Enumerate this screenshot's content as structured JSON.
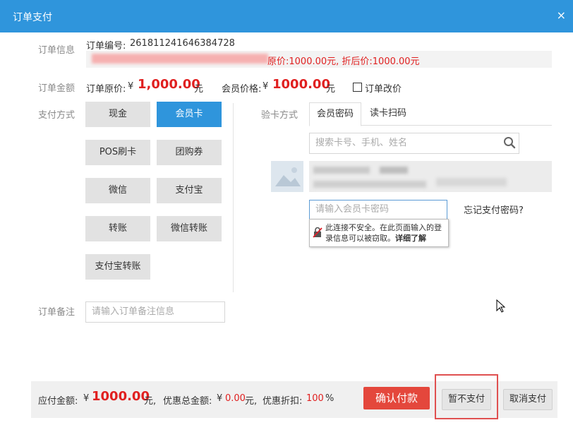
{
  "dialog": {
    "title": "订单支付",
    "close": "×"
  },
  "order_info": {
    "label": "订单信息",
    "order_no_label": "订单编号:",
    "order_no": "261811241646384728",
    "price_note": "原价:1000.00元, 折后价:1000.00元"
  },
  "amount": {
    "label": "订单金额",
    "orig_label": "订单原价:",
    "currency": "¥",
    "orig_value": "1,000.00",
    "unit": "元",
    "member_label": "会员价格:",
    "member_value": "1000.00",
    "change_label": "订单改价"
  },
  "payment": {
    "label": "支付方式",
    "methods": [
      "现金",
      "会员卡",
      "POS刷卡",
      "团购券",
      "微信",
      "支付宝",
      "转账",
      "微信转账",
      "支付宝转账"
    ],
    "selected": "会员卡"
  },
  "verify": {
    "label": "验卡方式",
    "tabs": [
      "会员密码",
      "读卡扫码"
    ],
    "search_placeholder": "搜索卡号、手机、姓名",
    "password_placeholder": "请输入会员卡密码",
    "forgot": "忘记支付密码?",
    "tooltip_text": "此连接不安全。在此页面输入的登录信息可以被窃取。",
    "tooltip_link": "详细了解"
  },
  "note": {
    "label": "订单备注",
    "placeholder": "请输入订单备注信息"
  },
  "footer": {
    "due_label": "应付金额:",
    "currency": "¥",
    "due_value": "1000.00",
    "unit": "元,",
    "discount_total_label": "优惠总金额:",
    "discount_total_currency": "¥",
    "discount_total_value": "0.00",
    "discount_total_unit": "元,",
    "discount_rate_label": "优惠折扣:",
    "discount_rate_value": "100",
    "percent": "%",
    "confirm": "确认付款",
    "defer": "暂不支付",
    "cancel": "取消支付"
  },
  "colors": {
    "primary": "#2f95dc",
    "danger": "#e4473c",
    "price": "#e02020"
  }
}
